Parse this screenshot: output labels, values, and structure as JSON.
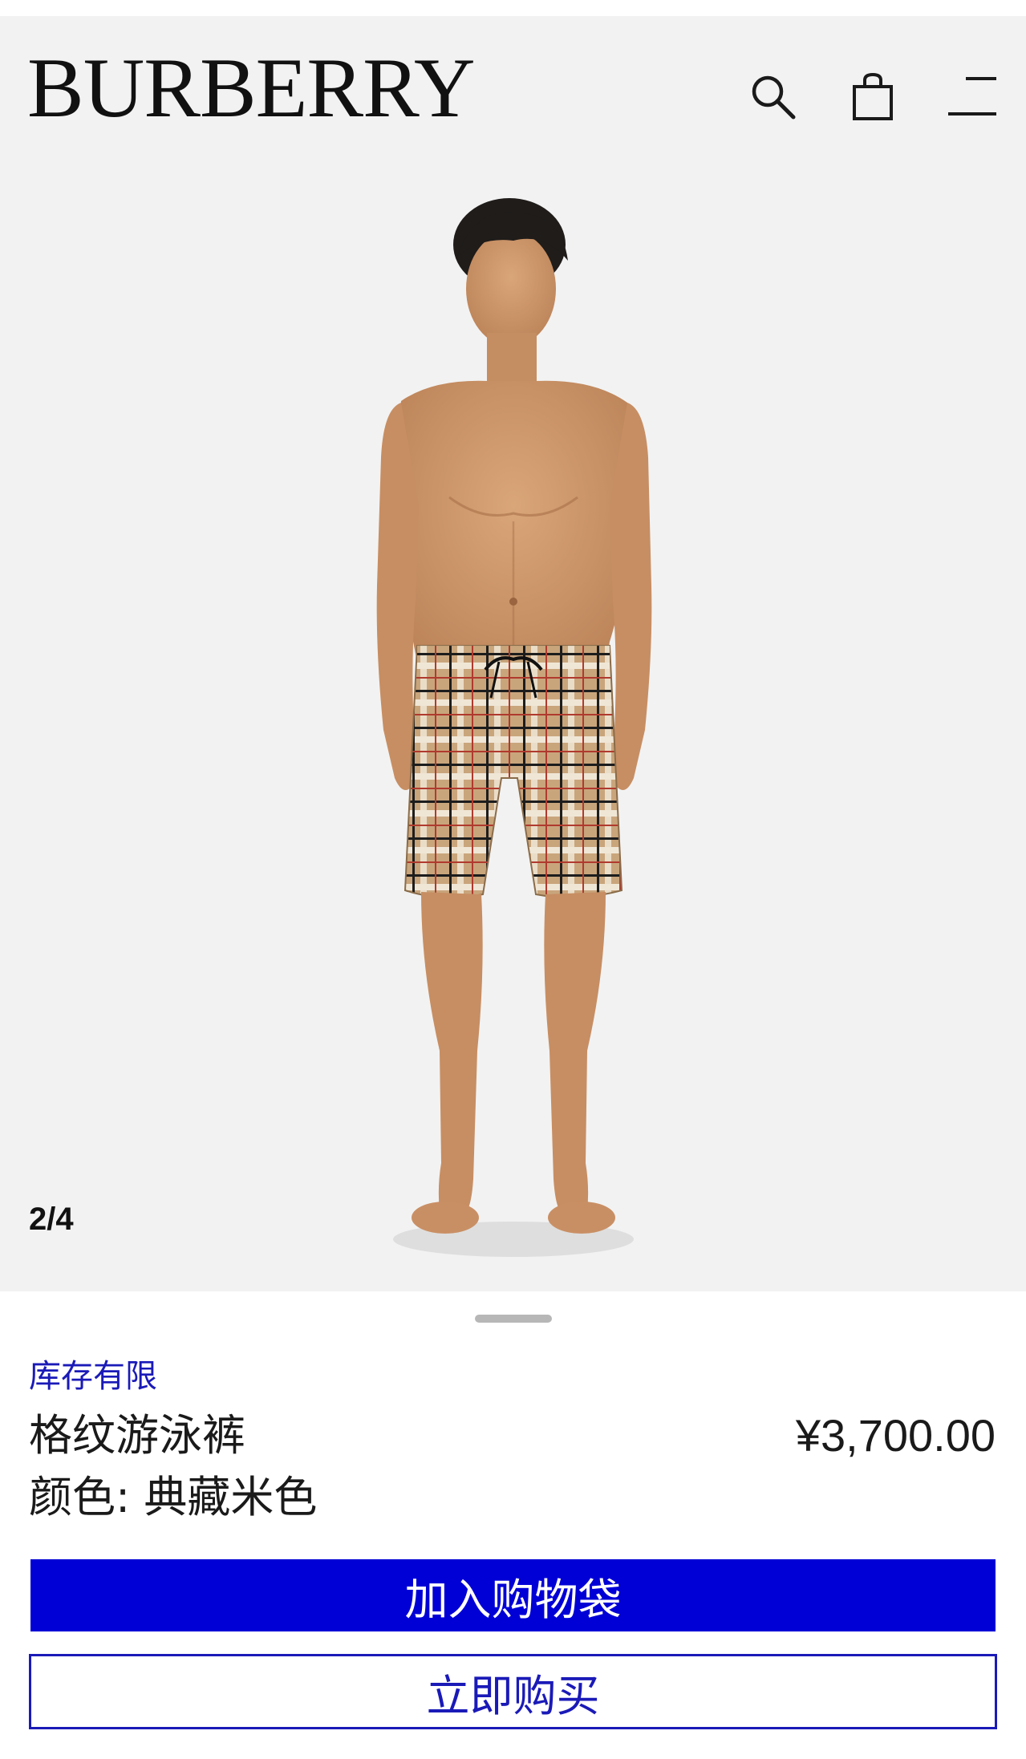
{
  "header": {
    "brand": "BURBERRY",
    "icons": [
      "search-icon",
      "shopping-bag-icon",
      "menu-icon"
    ]
  },
  "gallery": {
    "counter": "2/4",
    "image": "model-wearing-check-swim-shorts"
  },
  "product": {
    "stock_status": "库存有限",
    "name": "格纹游泳裤",
    "price": "¥3,700.00",
    "color_label": "颜色: 典藏米色"
  },
  "actions": {
    "add_to_bag": "加入购物袋",
    "buy_now": "立即购买"
  },
  "colors": {
    "primary_blue": "#0000d6",
    "link_blue": "#1a1ab8",
    "header_bg": "#f2f2f2",
    "text": "#1a1a1a"
  }
}
